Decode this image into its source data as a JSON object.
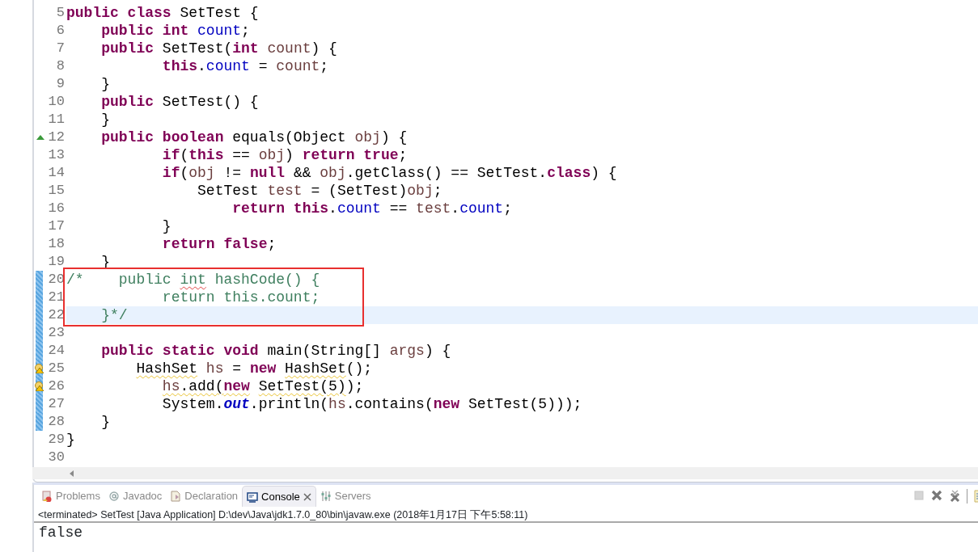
{
  "editor": {
    "lines": [
      {
        "number": "5",
        "kind": "plain",
        "changed": false,
        "current": false,
        "boxed": false,
        "tokens": [
          {
            "text": "public class ",
            "kind": "kw"
          },
          {
            "text": "SetTest {",
            "kind": "plain"
          }
        ]
      },
      {
        "number": "6",
        "kind": "plain",
        "changed": false,
        "current": false,
        "boxed": false,
        "tokens": [
          {
            "text": "    public int ",
            "kind": "kw"
          },
          {
            "text": "count",
            "kind": "field"
          },
          {
            "text": ";",
            "kind": "plain"
          }
        ]
      },
      {
        "number": "7",
        "kind": "plain",
        "changed": false,
        "current": false,
        "boxed": false,
        "tokens": [
          {
            "text": "    public ",
            "kind": "kw"
          },
          {
            "text": "SetTest(",
            "kind": "plain"
          },
          {
            "text": "int ",
            "kind": "kw"
          },
          {
            "text": "count",
            "kind": "local"
          },
          {
            "text": ") {",
            "kind": "plain"
          }
        ]
      },
      {
        "number": "8",
        "kind": "plain",
        "changed": false,
        "current": false,
        "boxed": false,
        "tokens": [
          {
            "text": "           this",
            "kind": "kw"
          },
          {
            "text": ".",
            "kind": "plain"
          },
          {
            "text": "count",
            "kind": "field"
          },
          {
            "text": " = ",
            "kind": "plain"
          },
          {
            "text": "count",
            "kind": "local"
          },
          {
            "text": ";",
            "kind": "plain"
          }
        ]
      },
      {
        "number": "9",
        "kind": "plain",
        "changed": false,
        "current": false,
        "boxed": false,
        "tokens": [
          {
            "text": "    }",
            "kind": "plain"
          }
        ]
      },
      {
        "number": "10",
        "kind": "plain",
        "changed": false,
        "current": false,
        "boxed": false,
        "tokens": [
          {
            "text": "    public ",
            "kind": "kw"
          },
          {
            "text": "SetTest() {",
            "kind": "plain"
          }
        ]
      },
      {
        "number": "11",
        "kind": "plain",
        "changed": false,
        "current": false,
        "boxed": false,
        "tokens": [
          {
            "text": "    }",
            "kind": "plain"
          }
        ]
      },
      {
        "number": "12",
        "kind": "override",
        "changed": false,
        "current": false,
        "boxed": false,
        "tokens": [
          {
            "text": "    public boolean ",
            "kind": "kw"
          },
          {
            "text": "equals(Object ",
            "kind": "plain"
          },
          {
            "text": "obj",
            "kind": "local"
          },
          {
            "text": ") {",
            "kind": "plain"
          }
        ]
      },
      {
        "number": "13",
        "kind": "plain",
        "changed": false,
        "current": false,
        "boxed": false,
        "tokens": [
          {
            "text": "           if",
            "kind": "kw"
          },
          {
            "text": "(",
            "kind": "plain"
          },
          {
            "text": "this",
            "kind": "kw"
          },
          {
            "text": " == ",
            "kind": "plain"
          },
          {
            "text": "obj",
            "kind": "local"
          },
          {
            "text": ") ",
            "kind": "plain"
          },
          {
            "text": "return true",
            "kind": "kw"
          },
          {
            "text": ";",
            "kind": "plain"
          }
        ]
      },
      {
        "number": "14",
        "kind": "plain",
        "changed": false,
        "current": false,
        "boxed": false,
        "tokens": [
          {
            "text": "           if",
            "kind": "kw"
          },
          {
            "text": "(",
            "kind": "plain"
          },
          {
            "text": "obj",
            "kind": "local"
          },
          {
            "text": " != ",
            "kind": "plain"
          },
          {
            "text": "null",
            "kind": "kw"
          },
          {
            "text": " && ",
            "kind": "plain"
          },
          {
            "text": "obj",
            "kind": "local"
          },
          {
            "text": ".getClass() == SetTest.",
            "kind": "plain"
          },
          {
            "text": "class",
            "kind": "kw"
          },
          {
            "text": ") {",
            "kind": "plain"
          }
        ]
      },
      {
        "number": "15",
        "kind": "plain",
        "changed": false,
        "current": false,
        "boxed": false,
        "tokens": [
          {
            "text": "               SetTest ",
            "kind": "plain"
          },
          {
            "text": "test",
            "kind": "local"
          },
          {
            "text": " = (SetTest)",
            "kind": "plain"
          },
          {
            "text": "obj",
            "kind": "local"
          },
          {
            "text": ";",
            "kind": "plain"
          }
        ]
      },
      {
        "number": "16",
        "kind": "plain",
        "changed": false,
        "current": false,
        "boxed": false,
        "tokens": [
          {
            "text": "                   return this",
            "kind": "kw"
          },
          {
            "text": ".",
            "kind": "plain"
          },
          {
            "text": "count",
            "kind": "field"
          },
          {
            "text": " == ",
            "kind": "plain"
          },
          {
            "text": "test",
            "kind": "local"
          },
          {
            "text": ".",
            "kind": "plain"
          },
          {
            "text": "count",
            "kind": "field"
          },
          {
            "text": ";",
            "kind": "plain"
          }
        ]
      },
      {
        "number": "17",
        "kind": "plain",
        "changed": false,
        "current": false,
        "boxed": false,
        "tokens": [
          {
            "text": "           }",
            "kind": "plain"
          }
        ]
      },
      {
        "number": "18",
        "kind": "plain",
        "changed": false,
        "current": false,
        "boxed": false,
        "tokens": [
          {
            "text": "           return false",
            "kind": "kw"
          },
          {
            "text": ";",
            "kind": "plain"
          }
        ]
      },
      {
        "number": "19",
        "kind": "plain",
        "changed": false,
        "current": false,
        "boxed": false,
        "tokens": [
          {
            "text": "    }",
            "kind": "plain"
          }
        ]
      },
      {
        "number": "20",
        "kind": "plain",
        "changed": true,
        "current": false,
        "boxed": true,
        "tokens": [
          {
            "text": "/*    public ",
            "kind": "comment"
          },
          {
            "text": "int",
            "kind": "comment",
            "underlined": true
          },
          {
            "text": " hashCode() {",
            "kind": "comment"
          }
        ]
      },
      {
        "number": "21",
        "kind": "plain",
        "changed": true,
        "current": false,
        "boxed": true,
        "tokens": [
          {
            "text": "           return this.count;",
            "kind": "comment"
          }
        ]
      },
      {
        "number": "22",
        "kind": "plain",
        "changed": true,
        "current": true,
        "boxed": true,
        "tokens": [
          {
            "text": "    }*/",
            "kind": "comment"
          }
        ]
      },
      {
        "number": "23",
        "kind": "plain",
        "changed": true,
        "current": false,
        "boxed": false
      },
      {
        "number": "24",
        "kind": "plain",
        "changed": true,
        "current": false,
        "boxed": false,
        "tokens": [
          {
            "text": "    public static void ",
            "kind": "kw"
          },
          {
            "text": "main(String[] ",
            "kind": "plain"
          },
          {
            "text": "args",
            "kind": "local"
          },
          {
            "text": ") {",
            "kind": "plain"
          }
        ]
      },
      {
        "number": "25",
        "kind": "warning",
        "changed": true,
        "current": false,
        "boxed": false,
        "tokens": [
          {
            "text": "        HashSet",
            "kind": "plain",
            "underlined": true
          },
          {
            "text": " hs",
            "kind": "local"
          },
          {
            "text": " = ",
            "kind": "plain"
          },
          {
            "text": "new ",
            "kind": "kw"
          },
          {
            "text": "HashSet",
            "kind": "plain",
            "underlined": true
          },
          {
            "text": "();",
            "kind": "plain"
          }
        ]
      },
      {
        "number": "26",
        "kind": "warning",
        "changed": true,
        "current": false,
        "boxed": false,
        "tokens": [
          {
            "text": "           hs",
            "kind": "local",
            "underlined": true
          },
          {
            "text": ".add(",
            "kind": "plain",
            "underlined": true
          },
          {
            "text": "new",
            "kind": "kw",
            "underlined": true
          },
          {
            "text": " SetTest(5)",
            "kind": "plain",
            "underlined": true
          },
          {
            "text": ");",
            "kind": "plain"
          }
        ]
      },
      {
        "number": "27",
        "kind": "plain",
        "changed": true,
        "current": false,
        "boxed": false,
        "tokens": [
          {
            "text": "           System.",
            "kind": "plain"
          },
          {
            "text": "out",
            "kind": "static"
          },
          {
            "text": ".println(",
            "kind": "plain"
          },
          {
            "text": "hs",
            "kind": "local"
          },
          {
            "text": ".contains(",
            "kind": "plain"
          },
          {
            "text": "new ",
            "kind": "kw"
          },
          {
            "text": "SetTest(5)));",
            "kind": "plain"
          }
        ]
      },
      {
        "number": "28",
        "kind": "plain",
        "changed": true,
        "current": false,
        "boxed": false,
        "tokens": [
          {
            "text": "    }",
            "kind": "plain"
          }
        ]
      },
      {
        "number": "29",
        "kind": "plain",
        "changed": false,
        "current": false,
        "boxed": false,
        "tokens": [
          {
            "text": "}",
            "kind": "plain"
          }
        ]
      },
      {
        "number": "30",
        "kind": "plain",
        "changed": false,
        "current": false,
        "boxed": false
      }
    ]
  },
  "console": {
    "tabs": [
      {
        "label": "Problems",
        "kind": "problems",
        "selected": false
      },
      {
        "label": "Javadoc",
        "kind": "javadoc",
        "selected": false
      },
      {
        "label": "Declaration",
        "kind": "declaration",
        "selected": false
      },
      {
        "label": "Console",
        "kind": "console",
        "selected": true
      },
      {
        "label": "Servers",
        "kind": "servers",
        "selected": false
      }
    ],
    "toolbar": [
      {
        "kind": "terminate",
        "disabled": true
      },
      {
        "kind": "remove",
        "disabled": false
      },
      {
        "kind": "remove_all",
        "disabled": false
      },
      {
        "kind": "separator"
      },
      {
        "kind": "document"
      }
    ],
    "status": "<terminated> SetTest [Java Application] D:\\dev\\Java\\jdk1.7.0_80\\bin\\javaw.exe (2018年1月17日 下午5:58:11)",
    "output": "false"
  }
}
